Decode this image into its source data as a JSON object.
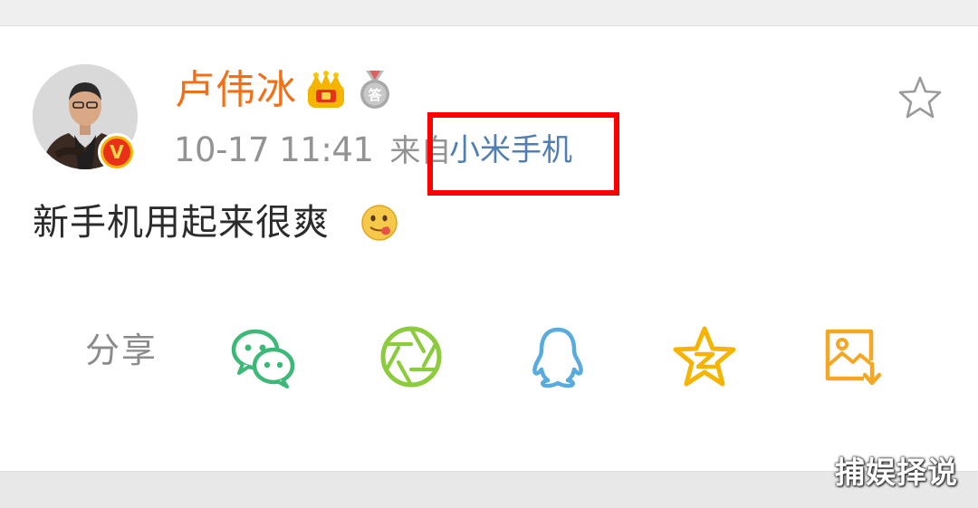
{
  "post": {
    "author": {
      "name": "卢伟冰",
      "verified_badge": "V"
    },
    "badges": {
      "medal_char": "答"
    },
    "time": "10-17 11:41",
    "source_prefix": "来自",
    "source_name": "小米手机",
    "text": "新手机用起来很爽"
  },
  "share": {
    "label": "分享",
    "targets": [
      "wechat-icon",
      "moments-icon",
      "qq-icon",
      "qzone-icon",
      "save-image-icon"
    ]
  },
  "watermark": "捕娱择说",
  "colors": {
    "author_name": "#f46f14",
    "source_link": "#4f7fb5",
    "highlight_box": "#ff0000",
    "wechat": "#3cb878",
    "moments": "#8ccc3c",
    "qq": "#5aabdd",
    "qzone": "#f5b400",
    "save_image": "#f5a623"
  }
}
